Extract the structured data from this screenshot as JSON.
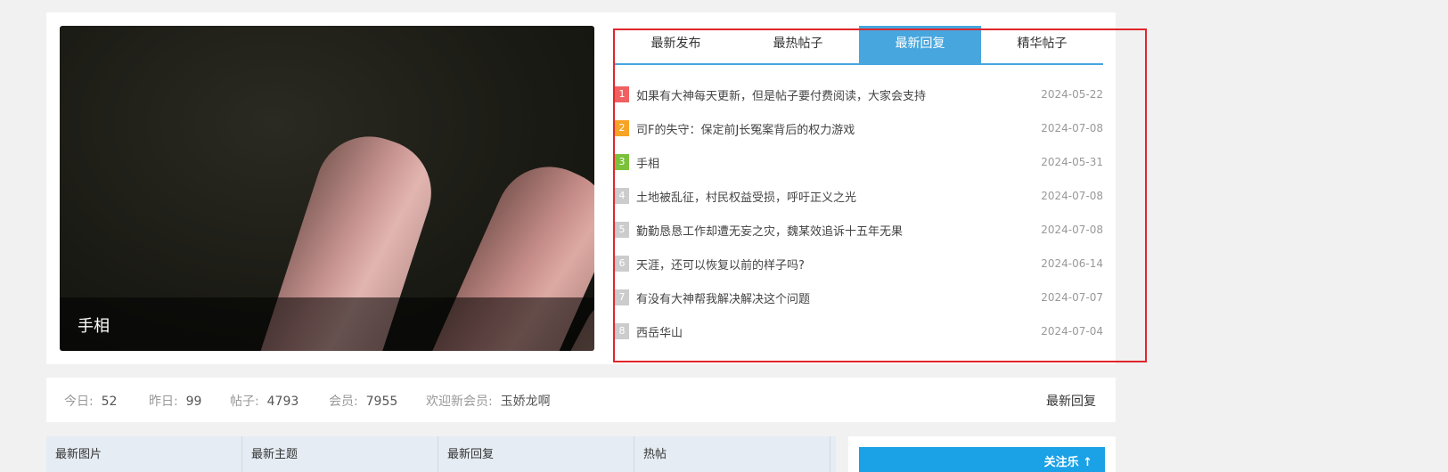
{
  "photo": {
    "caption": "手相"
  },
  "tabs": [
    "最新发布",
    "最热帖子",
    "最新回复",
    "精华帖子"
  ],
  "active_tab": 2,
  "posts": [
    {
      "rank": "1",
      "title": "如果有大神每天更新，但是帖子要付费阅读，大家会支持",
      "date": "2024-05-22",
      "badge_color": "#f06060"
    },
    {
      "rank": "2",
      "title": "司F的失守：保定前J长冤案背后的权力游戏",
      "date": "2024-07-08",
      "badge_color": "#f7a325"
    },
    {
      "rank": "3",
      "title": "手相",
      "date": "2024-05-31",
      "badge_color": "#7bc13c"
    },
    {
      "rank": "4",
      "title": "土地被乱征，村民权益受损，呼吁正义之光",
      "date": "2024-07-08",
      "badge_color": "#cccccc"
    },
    {
      "rank": "5",
      "title": "勤勤恳恳工作却遭无妄之灾，魏某效追诉十五年无果",
      "date": "2024-07-08",
      "badge_color": "#cccccc"
    },
    {
      "rank": "6",
      "title": "天涯，还可以恢复以前的样子吗?",
      "date": "2024-06-14",
      "badge_color": "#cccccc"
    },
    {
      "rank": "7",
      "title": "有没有大神帮我解决解决这个问题",
      "date": "2024-07-07",
      "badge_color": "#cccccc"
    },
    {
      "rank": "8",
      "title": "西岳华山",
      "date": "2024-07-04",
      "badge_color": "#cccccc"
    }
  ],
  "stats": {
    "today_label": "今日:",
    "today": "52",
    "yesterday_label": "昨日:",
    "yesterday": "99",
    "posts_label": "帖子:",
    "posts": "4793",
    "members_label": "会员:",
    "members": "7955",
    "welcome_label": "欢迎新会员:",
    "welcome_user": "玉娇龙啊",
    "more_link": "最新回复"
  },
  "bottom_tabs": [
    "最新图片",
    "最新主题",
    "最新回复",
    "热帖"
  ],
  "right_banner_text": "关注乐 ↑",
  "colors": {
    "accent": "#47a6de",
    "highlight_border": "#e0262b"
  }
}
